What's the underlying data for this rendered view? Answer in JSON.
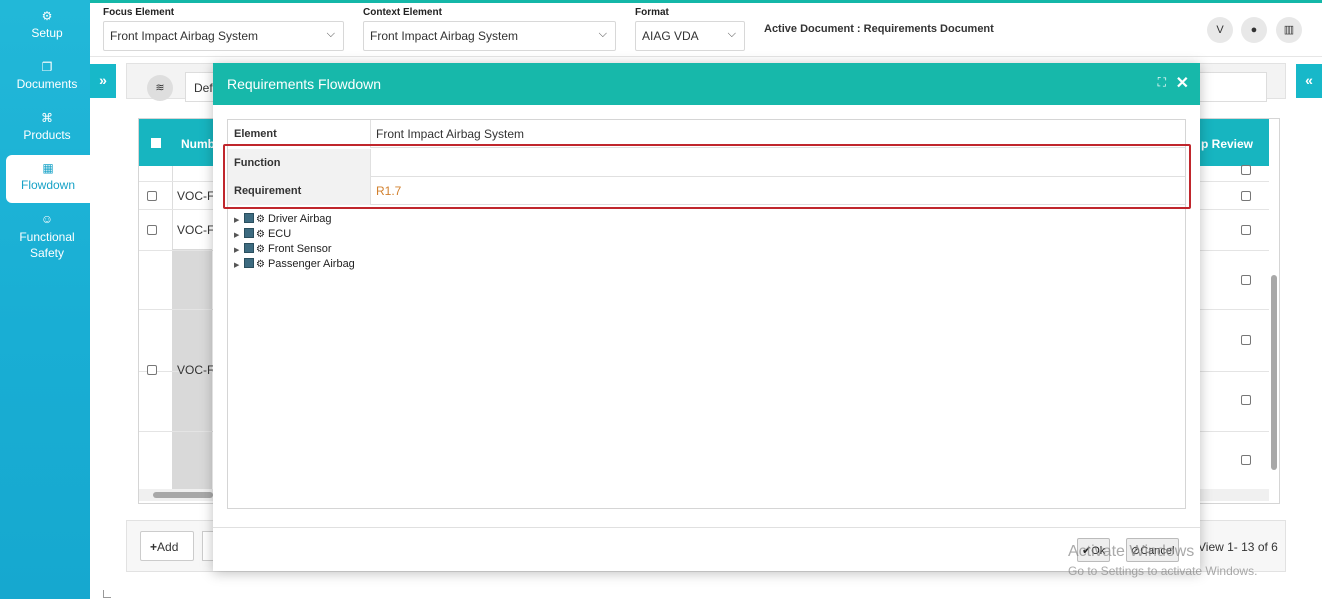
{
  "sidebar": {
    "items": [
      {
        "label": "Setup",
        "icon": "gears-icon"
      },
      {
        "label": "Documents",
        "icon": "documents-icon"
      },
      {
        "label": "Products",
        "icon": "products-icon"
      },
      {
        "label": "Flowdown",
        "icon": "building-icon"
      },
      {
        "label": "Functional Safety",
        "icon": "smile-icon"
      }
    ],
    "active": "Flowdown"
  },
  "topbar": {
    "focus_label": "Focus Element",
    "focus_value": "Front Impact Airbag System",
    "context_label": "Context Element",
    "context_value": "Front Impact Airbag System",
    "format_label": "Format",
    "format_value": "AIAG VDA",
    "active_document": "Active Document : Requirements Document"
  },
  "background": {
    "def_text": "Def",
    "col_number": "Numb",
    "col_review": "p Review",
    "rows": [
      "VOC-FI",
      "VOC-FI",
      "VOC-FI"
    ],
    "add_label": "Add",
    "view_text": "View 1- 13 of 6"
  },
  "modal": {
    "title": "Requirements Flowdown",
    "properties": [
      {
        "key": "Element",
        "value": "Front Impact Airbag System"
      },
      {
        "key": "Function",
        "value": ""
      },
      {
        "key": "Requirement",
        "value": "R1.7"
      }
    ],
    "tree": [
      "Driver Airbag",
      "ECU",
      "Front Sensor",
      "Passenger Airbag"
    ],
    "ok_label": "Ok",
    "cancel_label": "Cancel"
  },
  "watermark": {
    "line1": "Activate Windows",
    "line2": "Go to Settings to activate Windows."
  },
  "colors": {
    "sidebar": "#19aed4",
    "modal_header": "#17b8aa",
    "highlight": "#c0262c",
    "requirement_value": "#d2802e"
  }
}
